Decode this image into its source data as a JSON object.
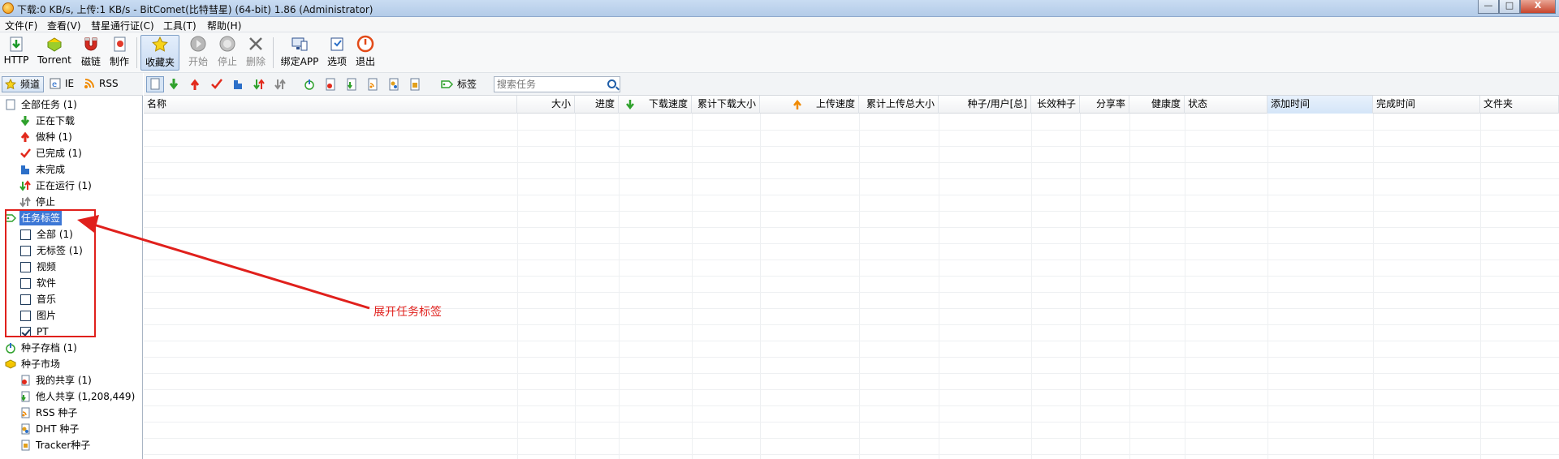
{
  "window": {
    "title": "下载:0 KB/s, 上传:1 KB/s - BitComet(比特彗星) (64-bit) 1.86 (Administrator)",
    "buttons": {
      "minimize": "—",
      "maximize": "□",
      "close": "X"
    }
  },
  "menu": [
    "文件(F)",
    "查看(V)",
    "彗星通行证(C)",
    "工具(T)",
    "帮助(H)"
  ],
  "toolbar": {
    "buttons": [
      {
        "label": "HTTP",
        "icon": "http-download-icon",
        "enabled": true
      },
      {
        "label": "Torrent",
        "icon": "torrent-icon",
        "enabled": true
      },
      {
        "label": "磁链",
        "icon": "magnet-icon",
        "enabled": true
      },
      {
        "label": "制作",
        "icon": "make-torrent-icon",
        "enabled": true
      },
      {
        "label": "收藏夹",
        "icon": "favorites-star-icon",
        "enabled": true,
        "active": true
      },
      {
        "label": "开始",
        "icon": "start-icon",
        "enabled": false
      },
      {
        "label": "停止",
        "icon": "stop-icon",
        "enabled": false
      },
      {
        "label": "删除",
        "icon": "delete-icon",
        "enabled": false
      },
      {
        "label": "绑定APP",
        "icon": "bind-app-icon",
        "enabled": true
      },
      {
        "label": "选项",
        "icon": "options-icon",
        "enabled": true
      },
      {
        "label": "退出",
        "icon": "exit-power-icon",
        "enabled": true
      }
    ]
  },
  "left_tabs": [
    {
      "label": "频道",
      "icon": "channel-star-icon",
      "active": true
    },
    {
      "label": "IE",
      "icon": "ie-icon",
      "active": false
    },
    {
      "label": "RSS",
      "icon": "rss-icon",
      "active": false
    }
  ],
  "tree": {
    "all_tasks": "全部任务 (1)",
    "downloading": "正在下载",
    "seeding": "做种 (1)",
    "completed": "已完成 (1)",
    "incomplete": "未完成",
    "running": "正在运行 (1)",
    "stopped": "停止",
    "task_tags": "任务标签",
    "tags": [
      {
        "label": "全部 (1)",
        "checked": false
      },
      {
        "label": "无标签 (1)",
        "checked": false
      },
      {
        "label": "视频",
        "checked": false
      },
      {
        "label": "软件",
        "checked": false
      },
      {
        "label": "音乐",
        "checked": false
      },
      {
        "label": "图片",
        "checked": false
      },
      {
        "label": "PT",
        "checked": true
      }
    ],
    "torrent_archive": "种子存档 (1)",
    "torrent_market": "种子市场",
    "my_share": "我的共享 (1)",
    "others_share": "他人共享 (1,208,449)",
    "rss_seeds": "RSS 种子",
    "dht_seeds": "DHT 种子",
    "tracker_seeds": "Tracker种子"
  },
  "subtoolbar": {
    "tag_label": "标签",
    "search_placeholder": "搜索任务"
  },
  "table": {
    "columns": [
      "名称",
      "大小",
      "进度",
      "下载速度",
      "累计下载大小",
      "上传速度",
      "累计上传总大小",
      "种子/用户[总]",
      "长效种子",
      "分享率",
      "健康度",
      "状态",
      "添加时间",
      "完成时间",
      "文件夹"
    ],
    "sorted_column": "添加时间",
    "rows": []
  },
  "annotation": {
    "text": "展开任务标签",
    "color": "#e0201c"
  },
  "colors": {
    "selection": "#3c77d6",
    "accent_red": "#e0201c"
  }
}
